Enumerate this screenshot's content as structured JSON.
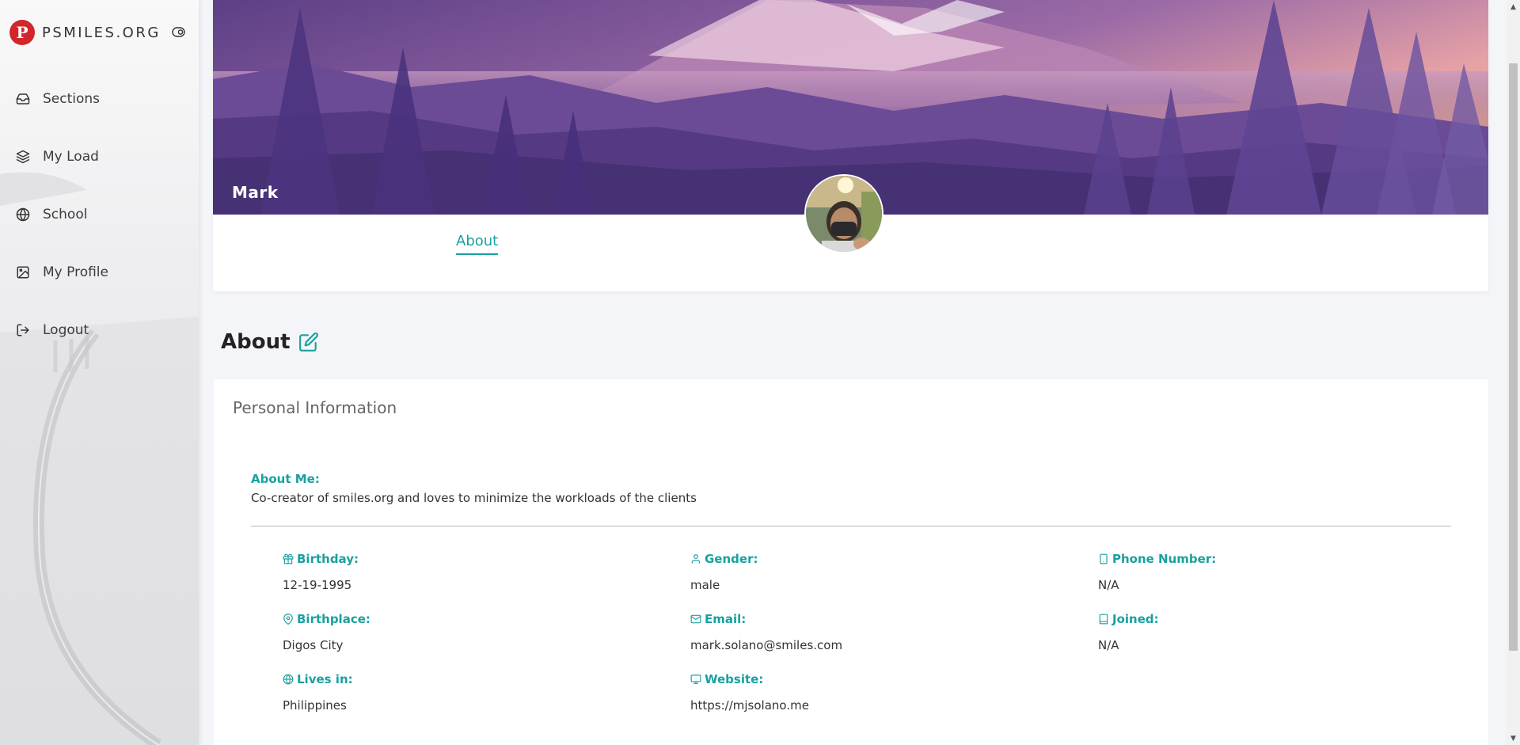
{
  "brand": {
    "logo_letter": "P",
    "name": "PSMILES.ORG"
  },
  "sidebar": {
    "items": [
      {
        "label": "Sections",
        "icon": "inbox-icon"
      },
      {
        "label": "My Load",
        "icon": "layers-icon"
      },
      {
        "label": "School",
        "icon": "globe-icon"
      },
      {
        "label": "My Profile",
        "icon": "image-icon"
      },
      {
        "label": "Logout",
        "icon": "logout-icon"
      }
    ]
  },
  "profile": {
    "name": "Mark",
    "tab_label": "About"
  },
  "about": {
    "title": "About",
    "card_title": "Personal Information",
    "about_me_label": "About Me:",
    "about_me_text": "Co-creator of smiles.org and loves to minimize the workloads of the clients",
    "fields": {
      "birthday": {
        "label": "Birthday:",
        "value": "12-19-1995",
        "icon": "gift-icon"
      },
      "gender": {
        "label": "Gender:",
        "value": "male",
        "icon": "user-icon"
      },
      "phone": {
        "label": "Phone Number:",
        "value": "N/A",
        "icon": "phone-icon"
      },
      "birthplace": {
        "label": "Birthplace:",
        "value": "Digos City",
        "icon": "map-pin-icon"
      },
      "email": {
        "label": "Email:",
        "value": "mark.solano@smiles.com",
        "icon": "mail-icon"
      },
      "joined": {
        "label": "Joined:",
        "value": "N/A",
        "icon": "book-icon"
      },
      "lives_in": {
        "label": "Lives in:",
        "value": "Philippines",
        "icon": "globe-icon"
      },
      "website": {
        "label": "Website:",
        "value": "https://mjsolano.me",
        "icon": "monitor-icon"
      }
    }
  },
  "colors": {
    "accent": "#1aa0a0",
    "brand": "#d1262c",
    "cover": "#4a3577"
  }
}
